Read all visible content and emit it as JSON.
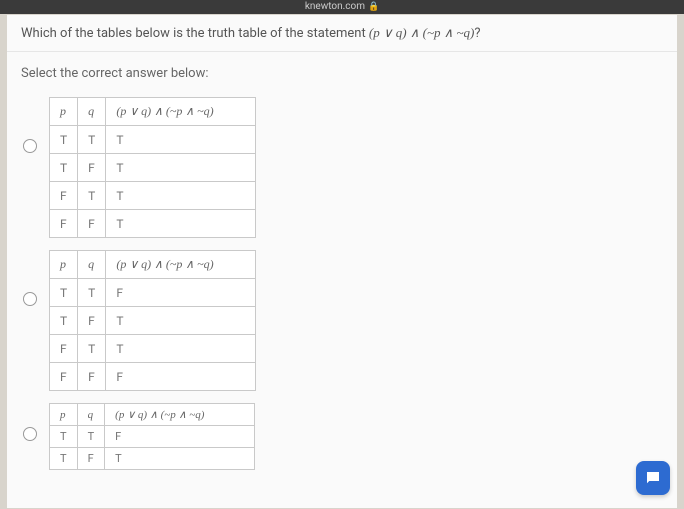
{
  "browser": {
    "domain": "knewton.com",
    "lock": "🔒"
  },
  "question": {
    "prefix": "Which of the tables below is the truth table of the statement ",
    "formula": "(p ∨ q) ∧ (~p ∧ ~q)",
    "suffix": "?"
  },
  "instruction": "Select the correct answer below:",
  "headers": {
    "p": "p",
    "q": "q",
    "expr": "(p ∨ q) ∧ (~p ∧ ~q)"
  },
  "options": [
    {
      "rows": [
        {
          "p": "T",
          "q": "T",
          "r": "T"
        },
        {
          "p": "T",
          "q": "F",
          "r": "T"
        },
        {
          "p": "F",
          "q": "T",
          "r": "T"
        },
        {
          "p": "F",
          "q": "F",
          "r": "T"
        }
      ]
    },
    {
      "rows": [
        {
          "p": "T",
          "q": "T",
          "r": "F"
        },
        {
          "p": "T",
          "q": "F",
          "r": "T"
        },
        {
          "p": "F",
          "q": "T",
          "r": "T"
        },
        {
          "p": "F",
          "q": "F",
          "r": "F"
        }
      ]
    },
    {
      "rows": [
        {
          "p": "T",
          "q": "T",
          "r": "F"
        },
        {
          "p": "T",
          "q": "F",
          "r": "T"
        }
      ]
    }
  ]
}
